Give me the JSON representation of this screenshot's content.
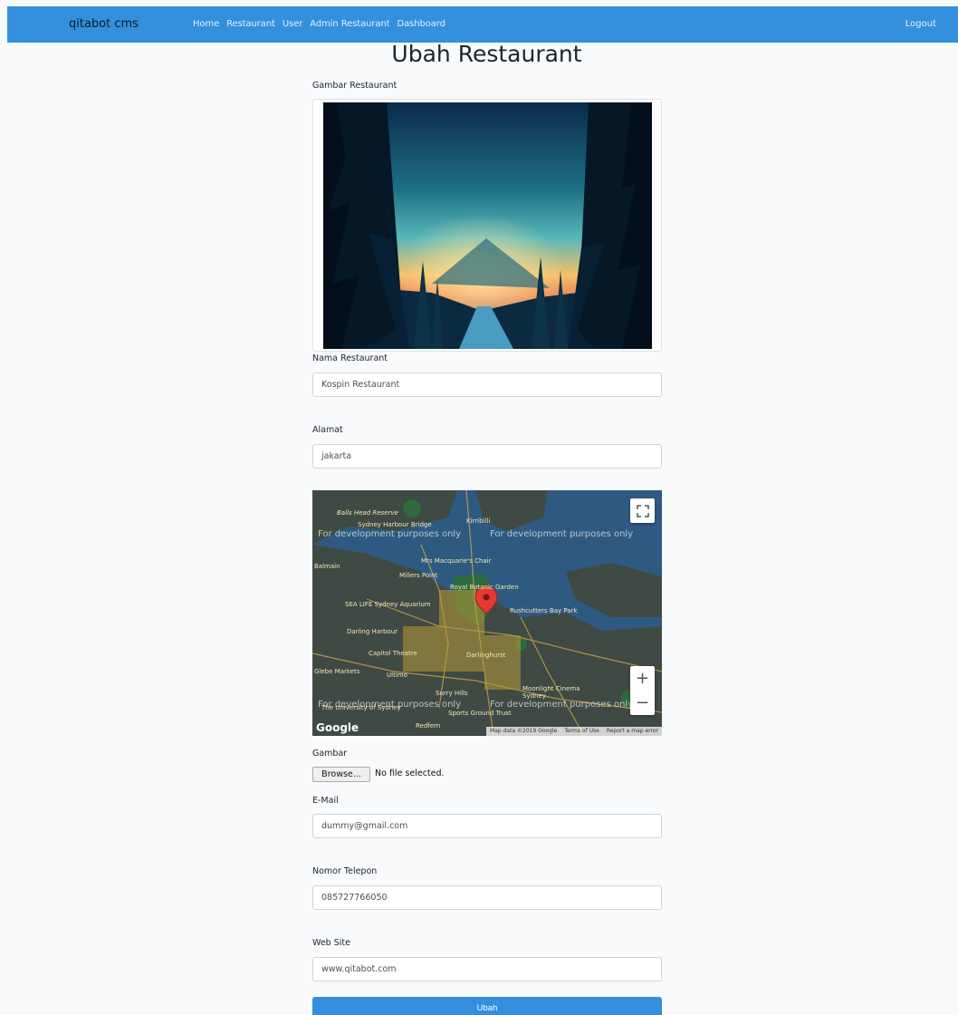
{
  "nav": {
    "brand": "qitabot cms",
    "links": [
      "Home",
      "Restaurant",
      "User",
      "Admin Restaurant",
      "Dashboard"
    ],
    "logout": "Logout"
  },
  "page": {
    "title": "Ubah Restaurant"
  },
  "form": {
    "image_label": "Gambar Restaurant",
    "name_label": "Nama Restaurant",
    "name_value": "Kospin Restaurant",
    "address_label": "Alamat",
    "address_value": "jakarta",
    "file_label": "Gambar",
    "browse_label": "Browse...",
    "file_status": "No file selected.",
    "email_label": "E-Mail",
    "email_value": "dummy@gmail.com",
    "phone_label": "Nomor Telepon",
    "phone_value": "085727766050",
    "website_label": "Web Site",
    "website_value": "www.qitabot.com",
    "submit_label": "Ubah"
  },
  "map": {
    "dev_notice": "For development purposes only",
    "places": [
      "Balls Head Reserve",
      "Sydney Harbour Bridge",
      "Kirribilli",
      "Mrs Macquarie's Chair",
      "Balmain",
      "Millers Point",
      "Royal Botanic Garden",
      "SEA LIFE Sydney Aquarium",
      "Rushcutters Bay Park",
      "Darling Harbour",
      "Capitol Theatre",
      "Darlinghurst",
      "Glebe Markets",
      "Ultimo",
      "Surry Hills",
      "Moonlight Cinema Sydney",
      "Sports Ground Trust",
      "The University of Sydney",
      "Redfern"
    ],
    "logo": "Google",
    "footer": [
      "Map data ©2019 Google",
      "Terms of Use",
      "Report a map error"
    ],
    "zoom_in": "+",
    "zoom_out": "−"
  },
  "colors": {
    "primary": "#3490dc",
    "background": "#f8fafc",
    "water": "#2e5a82"
  }
}
